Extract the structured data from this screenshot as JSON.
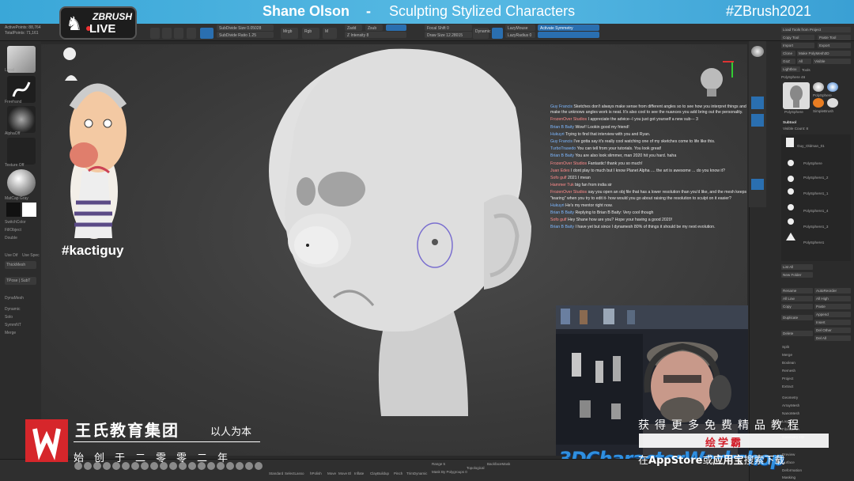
{
  "banner": {
    "host": "Shane Olson",
    "separator": "-",
    "title": "Sculpting Stylized Characters",
    "hashtag": "#ZBrush2021"
  },
  "zbrush_logo": {
    "line1": "ZBRUSH",
    "line2": "LIVE"
  },
  "top_toolbar": {
    "active_points": "ActivePoints: 88,764",
    "total_points": "TotalPoints: 71,161",
    "sub_size": "SubDivide Size 0.05028",
    "sub_ratio": "SubDivide Ratio 1.25",
    "mrgb": "Mrgb",
    "rgb": "Rgb",
    "m": "M",
    "zadd": "Zadd",
    "zsub": "Zsub",
    "z_intensity": "Z Intensity 8",
    "focal_shift": "Focal Shift 0",
    "draw_size": "Draw Size 12.28015",
    "dynamic": "Dynamic",
    "active_symmetry": "Activate Symmetry",
    "lazy_mouse": "LazyMouse",
    "lazy_radius": "LazyRadius 0"
  },
  "left_shelf": {
    "items": [
      "Local",
      "Freehand",
      "AlphaOff",
      "Texture Off",
      "MatCap Gray",
      "SwitchColor",
      "FillObject",
      "Double",
      "Use Dif",
      "Use Spec",
      "ThickMesh",
      "TPose | SubT",
      "DynaMesh",
      "Dynamic",
      "Solo",
      "SymmNT",
      "Merge"
    ]
  },
  "viewport": {
    "caricature_tag": "#kactiguy"
  },
  "chat": [
    {
      "user": "Guy Francis",
      "color": "blue",
      "text": "Sketches don't always make sense from different angles so to see how you interpret things and make the unknows angles work is neat. It's also cool to see the nuances you add bring out the personality."
    },
    {
      "user": "FrozenOver Studios",
      "color": "red",
      "text": "I appreciate the advice--I you just got yourself a new sub--- 3"
    },
    {
      "user": "Brian B Baity",
      "color": "blue",
      "text": "Wow!! Lookin good my friend!"
    },
    {
      "user": "Hukuyri",
      "color": "blue",
      "text": "Trying to find that interview with you and Ryan."
    },
    {
      "user": "Guy Francis",
      "color": "blue",
      "text": "I've gotta say it's really cool watching one of my sketches come to life like this."
    },
    {
      "user": "TurboTrasedo",
      "color": "blue",
      "text": "You can tell from your tutorials. You look great!"
    },
    {
      "user": "Brian B Baity",
      "color": "blue",
      "text": "You are also look slimmer, man 2020 hit you hard. haha"
    },
    {
      "user": "FrozenOver Studios",
      "color": "red",
      "text": "Fantastic! thank you so much!"
    },
    {
      "user": "Juan Edes",
      "color": "red",
      "text": "I dont play to much but I know Planet Alpha .... the art is awesome ... do you know it?"
    },
    {
      "user": "Sofo gulf",
      "color": "red",
      "text": "2021 I mean"
    },
    {
      "user": "Hammer Tuk",
      "color": "red",
      "text": "big fan from india sir"
    },
    {
      "user": "FrozenOver Studios",
      "color": "red",
      "text": "say you open an obj file that has a lower resolution than you'd like, and the mesh keeps \"tearing\" when you try to edit it- how would you go about raising the resolution to sculpt on it easier?"
    },
    {
      "user": "Hukuyri",
      "color": "blue",
      "text": "He's my mentor right now."
    },
    {
      "user": "Brian B Baity",
      "color": "blue",
      "text": "Replying to Brian B Baity: Very cool though"
    },
    {
      "user": "Sofo gulf",
      "color": "red",
      "text": "Hey Shane how are you? Hope your having a good 2020!"
    },
    {
      "user": "Brian B Baity",
      "color": "blue",
      "text": "I have yet but since I dynamesh 80% of things it should be my next evolution."
    }
  ],
  "right_panel": {
    "top": [
      "Load Tools from Project",
      "Copy Tool",
      "Paste Tool",
      "Import",
      "Export",
      "Clone",
      "Make PolyMesh3D",
      "GoZ",
      "All",
      "Visible",
      "Lightbox",
      "Tools",
      "PolySphere 46"
    ],
    "tool_names": [
      "PolySphere",
      "PolySphere",
      "SphereBrush",
      "SimpleBrush",
      "EraserB"
    ],
    "subtool_header": "Subtool",
    "visible_count": "Visible Count: 8",
    "subtools": [
      "Guy_Oldman_01",
      "PolySphere",
      "PolySphere1_2",
      "PolySphere1_1",
      "PolySphere1_4",
      "PolySphere1_3",
      "PolySphere1"
    ],
    "actions": [
      "List All",
      "New Folder",
      "Rename",
      "AutoReorder",
      "All Low",
      "All High",
      "Copy",
      "Paste",
      "Duplicate",
      "Append",
      "Insert",
      "Delete",
      "Del Other",
      "Del All",
      "Split",
      "Merge",
      "Boolean",
      "Remesh",
      "Project",
      "Extract",
      "Geometry",
      "ArrayMesh",
      "NanoMesh",
      "Layers",
      "FiberMesh",
      "Geometry HD",
      "Preview",
      "Surface",
      "Deformation",
      "Masking"
    ]
  },
  "bottom_toolbar": {
    "brushes": [
      "Standard",
      "SelectLasso",
      "hPolish",
      "Move",
      "Move El",
      "Inflate",
      "ClayBuildup",
      "Pinch",
      "TrimDynamic",
      "hPolish",
      "Smooth",
      "Fill",
      "ClayTubes",
      "ClipCurve",
      "TrimCurve",
      "Topology",
      "IMM_ZC",
      "ZModeler",
      "Knife",
      "Dam_Standard"
    ],
    "range": "Range 5",
    "mask_by_polygroups": "Mask By Polygroups 0",
    "backface_mask": "BackfaceMask",
    "topological": "Topological"
  },
  "watermark_left": {
    "company": "王氏教育集团",
    "slogan": "以人为本",
    "founded": "始创于二零零二年"
  },
  "watermark_right": {
    "line1": "获得更多免费精品教程",
    "brand": "绘学霸",
    "line3_pre": "在",
    "appstore": "AppStore",
    "line3_mid": "或",
    "appstore2": "应用宝",
    "line3_post": "搜索下载"
  },
  "character_workshop": "3DCharacterWorkshop"
}
